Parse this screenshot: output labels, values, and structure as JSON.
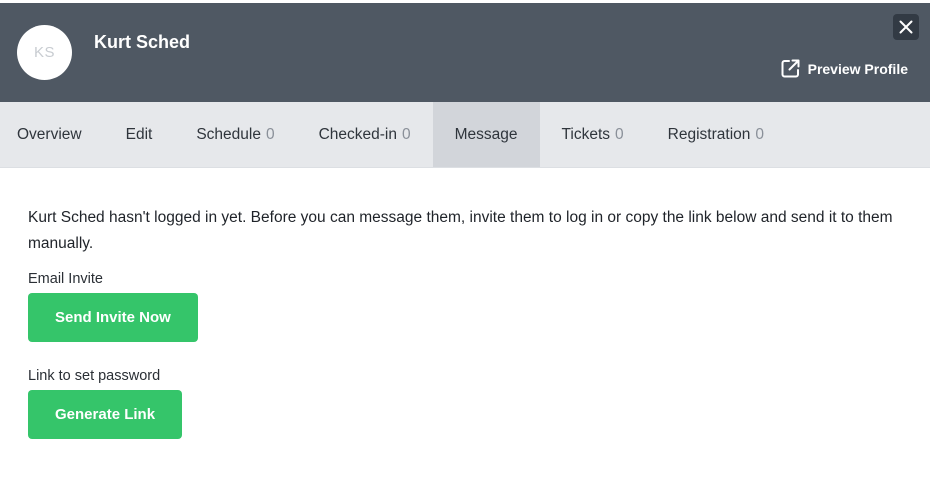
{
  "header": {
    "avatar_initials": "KS",
    "name": "Kurt Sched",
    "preview_label": "Preview Profile",
    "close_icon": "close-icon",
    "preview_icon": "external-link-icon"
  },
  "tabs": [
    {
      "label": "Overview",
      "count": ""
    },
    {
      "label": "Edit",
      "count": ""
    },
    {
      "label": "Schedule",
      "count": "0"
    },
    {
      "label": "Checked-in",
      "count": "0"
    },
    {
      "label": "Message",
      "count": "",
      "active": true
    },
    {
      "label": "Tickets",
      "count": "0"
    },
    {
      "label": "Registration",
      "count": "0"
    }
  ],
  "main": {
    "notice": "Kurt Sched hasn't logged in yet. Before you can message them, invite them to log in or copy the link below and send it to them manually.",
    "email_invite_label": "Email Invite",
    "send_invite_button": "Send Invite Now",
    "link_label": "Link to set password",
    "generate_link_button": "Generate Link"
  },
  "colors": {
    "header_bg": "#4f5863",
    "tabs_bg": "#e6e8eb",
    "active_tab_bg": "#d2d5da",
    "accent_green": "#35c56a"
  }
}
